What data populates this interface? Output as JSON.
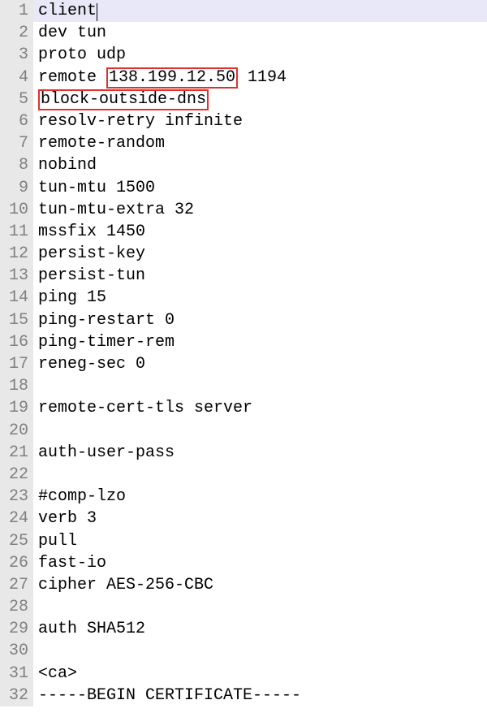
{
  "editor": {
    "current_line": 1,
    "highlight_boxes": {
      "line4_ip": "138.199.12.50",
      "line5_directive": "block-outside-dns"
    },
    "lines": [
      {
        "num": "1",
        "text": "client",
        "cursor_after": true
      },
      {
        "num": "2",
        "text": "dev tun"
      },
      {
        "num": "3",
        "text": "proto udp"
      },
      {
        "num": "4",
        "prefix": "remote ",
        "box_key": "line4_ip",
        "suffix": " 1194"
      },
      {
        "num": "5",
        "prefix": "",
        "box_key": "line5_directive",
        "suffix": ""
      },
      {
        "num": "6",
        "text": "resolv-retry infinite"
      },
      {
        "num": "7",
        "text": "remote-random"
      },
      {
        "num": "8",
        "text": "nobind"
      },
      {
        "num": "9",
        "text": "tun-mtu 1500"
      },
      {
        "num": "10",
        "text": "tun-mtu-extra 32"
      },
      {
        "num": "11",
        "text": "mssfix 1450"
      },
      {
        "num": "12",
        "text": "persist-key"
      },
      {
        "num": "13",
        "text": "persist-tun"
      },
      {
        "num": "14",
        "text": "ping 15"
      },
      {
        "num": "15",
        "text": "ping-restart 0"
      },
      {
        "num": "16",
        "text": "ping-timer-rem"
      },
      {
        "num": "17",
        "text": "reneg-sec 0"
      },
      {
        "num": "18",
        "text": ""
      },
      {
        "num": "19",
        "text": "remote-cert-tls server"
      },
      {
        "num": "20",
        "text": ""
      },
      {
        "num": "21",
        "text": "auth-user-pass"
      },
      {
        "num": "22",
        "text": ""
      },
      {
        "num": "23",
        "text": "#comp-lzo"
      },
      {
        "num": "24",
        "text": "verb 3"
      },
      {
        "num": "25",
        "text": "pull"
      },
      {
        "num": "26",
        "text": "fast-io"
      },
      {
        "num": "27",
        "text": "cipher AES-256-CBC"
      },
      {
        "num": "28",
        "text": ""
      },
      {
        "num": "29",
        "text": "auth SHA512"
      },
      {
        "num": "30",
        "text": ""
      },
      {
        "num": "31",
        "text": "<ca>"
      },
      {
        "num": "32",
        "text": "-----BEGIN CERTIFICATE-----"
      }
    ]
  }
}
